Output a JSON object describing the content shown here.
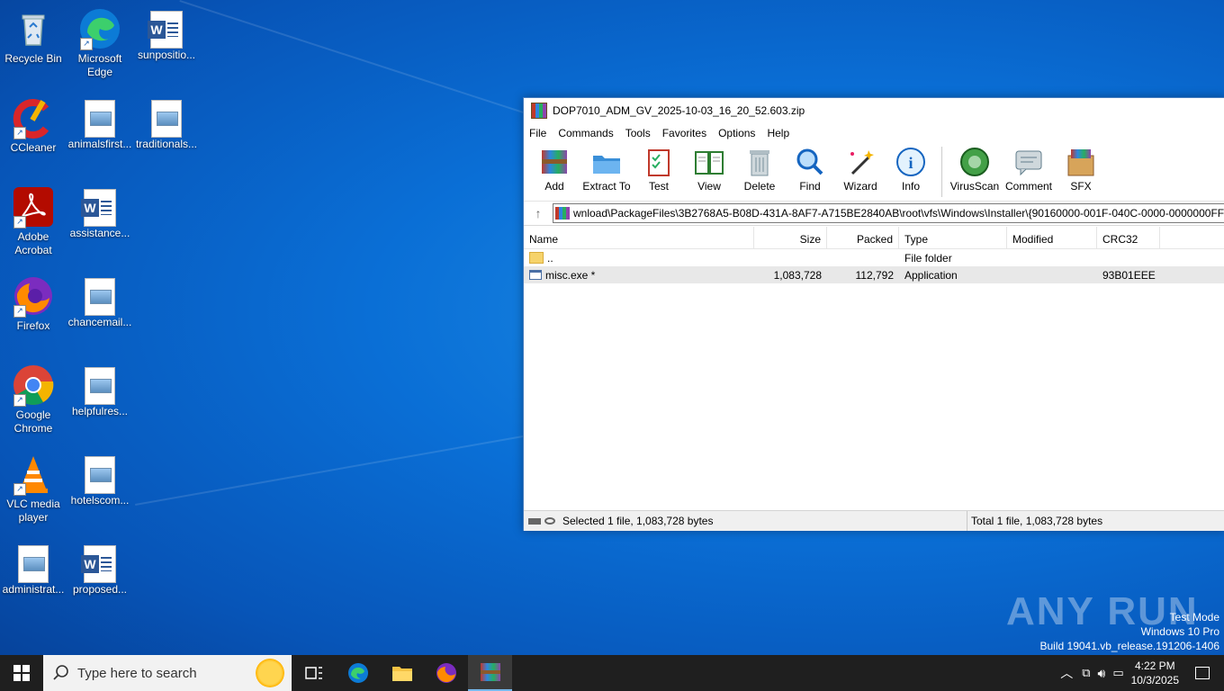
{
  "desktop": {
    "icons": [
      {
        "label": "Recycle Bin"
      },
      {
        "label": "Microsoft Edge"
      },
      {
        "label": "sunpositio..."
      },
      {
        "label": "CCleaner"
      },
      {
        "label": "animalsfirst..."
      },
      {
        "label": "traditionals..."
      },
      {
        "label": "Adobe Acrobat"
      },
      {
        "label": "assistance..."
      },
      {
        "label": "Firefox"
      },
      {
        "label": "chancemail..."
      },
      {
        "label": "Google Chrome"
      },
      {
        "label": "helpfulres..."
      },
      {
        "label": "VLC media player"
      },
      {
        "label": "hotelscom..."
      },
      {
        "label": "administrat..."
      },
      {
        "label": "proposed..."
      }
    ]
  },
  "window": {
    "title": "DOP7010_ADM_GV_2025-10-03_16_20_52.603.zip",
    "menu": [
      "File",
      "Commands",
      "Tools",
      "Favorites",
      "Options",
      "Help"
    ],
    "toolbar": [
      "Add",
      "Extract To",
      "Test",
      "View",
      "Delete",
      "Find",
      "Wizard",
      "Info",
      "VirusScan",
      "Comment",
      "SFX"
    ],
    "address": "wnload\\PackageFiles\\3B2768A5-B08D-431A-8AF7-A715BE2840AB\\root\\vfs\\Windows\\Installer\\{90160000-001F-040C-0000-0000000FF1",
    "columns": {
      "name": "Name",
      "size": "Size",
      "packed": "Packed",
      "type": "Type",
      "modified": "Modified",
      "crc": "CRC32"
    },
    "rows": [
      {
        "name": "..",
        "size": "",
        "packed": "",
        "type": "File folder",
        "modified": "",
        "crc": ""
      },
      {
        "name": "misc.exe *",
        "size": "1,083,728",
        "packed": "112,792",
        "type": "Application",
        "modified": "",
        "crc": "93B01EEE"
      }
    ],
    "status_left": "Selected 1 file, 1,083,728 bytes",
    "status_right": "Total 1 file, 1,083,728 bytes"
  },
  "taskbar": {
    "search_placeholder": "Type here to search",
    "time": "4:22 PM",
    "date": "10/3/2025"
  },
  "watermark": {
    "brand": "ANY RUN",
    "line1": "Test Mode",
    "line2": "Windows 10 Pro",
    "line3": "Build 19041.vb_release.191206-1406"
  }
}
